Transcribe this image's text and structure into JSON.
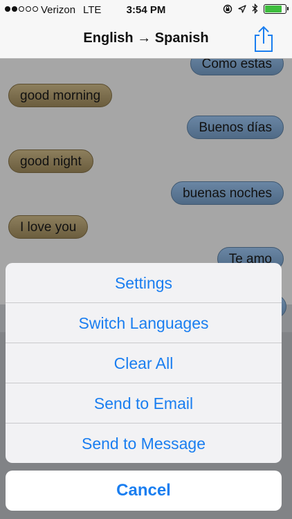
{
  "status_bar": {
    "carrier": "Verizon",
    "network": "LTE",
    "time": "3:54 PM",
    "icons": [
      "lock-rotation-icon",
      "location-icon",
      "bluetooth-icon",
      "battery-icon"
    ],
    "battery_level": 0.9,
    "battery_color": "#3dbd3d"
  },
  "nav": {
    "title": "English → Spanish",
    "share_icon": "share-icon"
  },
  "conversation": {
    "messages": [
      {
        "side": "out",
        "text": "Como estas"
      },
      {
        "side": "in",
        "text": "good morning"
      },
      {
        "side": "out",
        "text": "Buenos días"
      },
      {
        "side": "in",
        "text": "good night"
      },
      {
        "side": "out",
        "text": "buenas noches"
      },
      {
        "side": "in",
        "text": "I love you"
      },
      {
        "side": "out",
        "text": "Te amo"
      }
    ]
  },
  "action_sheet": {
    "items": [
      "Settings",
      "Switch Languages",
      "Clear All",
      "Send to Email",
      "Send to Message"
    ],
    "cancel_label": "Cancel",
    "accent_color": "#1a7ef0"
  }
}
